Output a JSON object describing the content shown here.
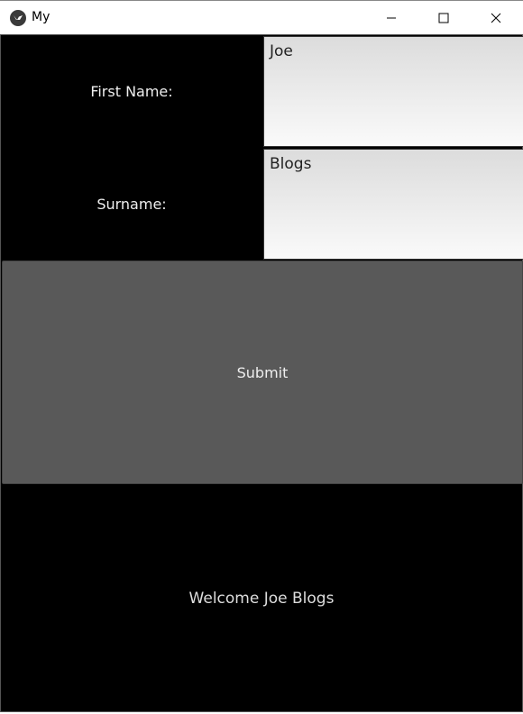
{
  "window": {
    "title": "My",
    "icon": "kivy-logo-icon"
  },
  "form": {
    "first_name_label": "First Name:",
    "first_name_value": "Joe",
    "surname_label": "Surname:",
    "surname_value": "Blogs"
  },
  "submit_label": "Submit",
  "welcome_text": "Welcome Joe Blogs",
  "colors": {
    "background": "#000000",
    "button": "#595959"
  }
}
